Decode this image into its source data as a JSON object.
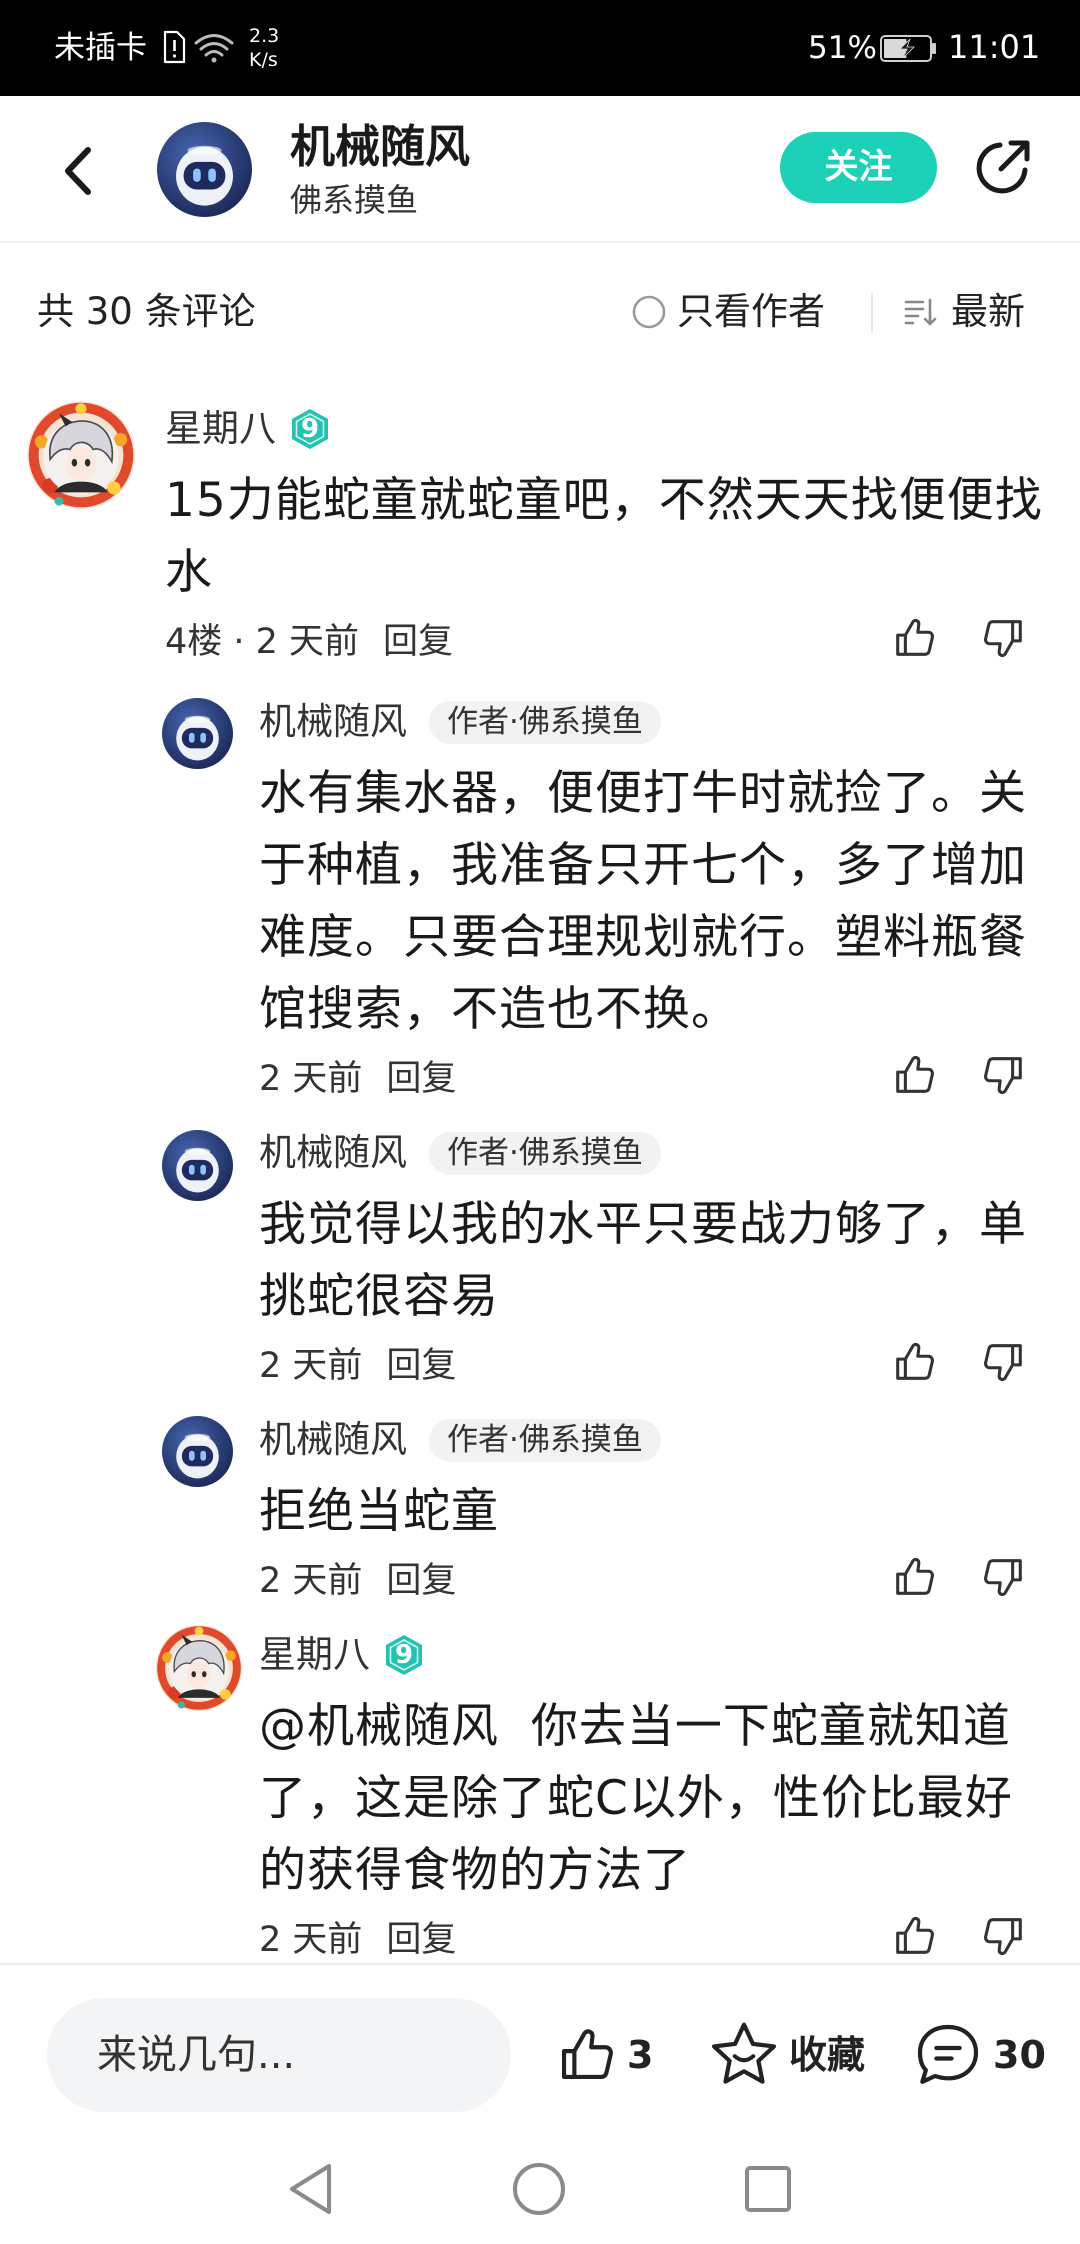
{
  "status_bar": {
    "carrier": "未插卡",
    "net_speed_value": "2.3",
    "net_speed_unit": "K/s",
    "battery_percent_label": "51%",
    "battery_level": 0.51,
    "time": "11:01",
    "icons": [
      "sim-alert-icon",
      "wifi-icon",
      "battery-charging-icon"
    ]
  },
  "header": {
    "author_name": "机械随风",
    "author_tagline": "佛系摸鱼",
    "author_avatar": "robot-avatar",
    "follow_label": "关注",
    "icons": {
      "back": "chevron-left-icon",
      "share": "share-icon"
    }
  },
  "filter_bar": {
    "comment_count_label": "共 30 条评论",
    "author_only_label": "只看作者",
    "author_only_checked": false,
    "sort_label": "最新",
    "icons": {
      "author_only": "radio-circle-icon",
      "sort": "sort-icon"
    }
  },
  "thread": {
    "comment": {
      "user": "星期八",
      "avatar": "anime-avatar",
      "level": "9",
      "text_lines": [
        "15力能蛇童就蛇童吧，不然天天找便便找",
        "水"
      ],
      "meta": "4楼 · 2 天前",
      "reply_label": "回复"
    },
    "replies": [
      {
        "user": "机械随风",
        "avatar": "robot-avatar",
        "badge": "作者·佛系摸鱼",
        "text_lines": [
          "水有集水器，便便打牛时就捡了。关",
          "于种植，我准备只开七个，多了增加",
          "难度。只要合理规划就行。塑料瓶餐",
          "馆搜索，不造也不换。"
        ],
        "meta": "2 天前",
        "reply_label": "回复"
      },
      {
        "user": "机械随风",
        "avatar": "robot-avatar",
        "badge": "作者·佛系摸鱼",
        "text_lines": [
          "我觉得以我的水平只要战力够了，单",
          "挑蛇很容易"
        ],
        "meta": "2 天前",
        "reply_label": "回复"
      },
      {
        "user": "机械随风",
        "avatar": "robot-avatar",
        "badge": "作者·佛系摸鱼",
        "text_lines": [
          "拒绝当蛇童"
        ],
        "meta": "2 天前",
        "reply_label": "回复"
      },
      {
        "user": "星期八",
        "avatar": "anime-avatar",
        "level": "9",
        "text_lines": [
          "@机械随风  你去当一下蛇童就知道",
          "了，这是除了蛇C以外，性价比最好",
          "的获得食物的方法了"
        ],
        "meta": "2 天前",
        "reply_label": "回复"
      }
    ]
  },
  "bottom_bar": {
    "input_placeholder": "来说几句...",
    "like_count": "3",
    "favorite_label": "收藏",
    "comment_count": "30",
    "icons": [
      "thumbs-up-icon",
      "star-icon",
      "comment-bubble-icon"
    ]
  },
  "nav_bar": {
    "icons": [
      "nav-back-icon",
      "nav-home-icon",
      "nav-recents-icon"
    ]
  },
  "colors": {
    "accent": "#1dd1b9",
    "level": "#22c3b3",
    "text_primary": "#1a1a1a",
    "text_secondary": "#333333",
    "input_bg": "#f3f4f6",
    "status_bar_bg": "#000000"
  }
}
